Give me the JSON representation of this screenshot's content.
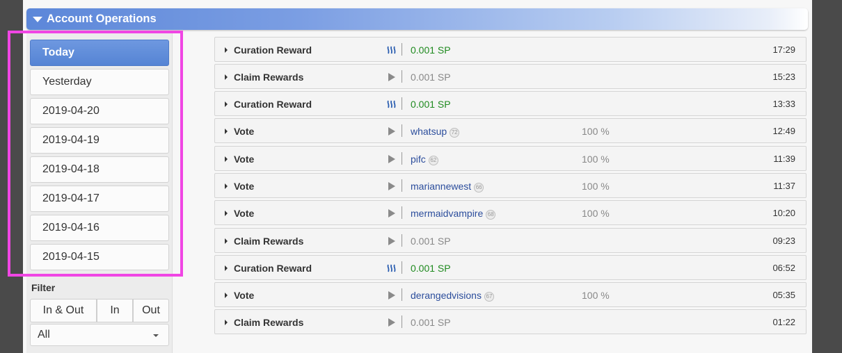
{
  "section": {
    "title": "Account Operations"
  },
  "dates": [
    {
      "label": "Today",
      "active": true
    },
    {
      "label": "Yesterday",
      "active": false
    },
    {
      "label": "2019-04-20",
      "active": false
    },
    {
      "label": "2019-04-19",
      "active": false
    },
    {
      "label": "2019-04-18",
      "active": false
    },
    {
      "label": "2019-04-17",
      "active": false
    },
    {
      "label": "2019-04-16",
      "active": false
    },
    {
      "label": "2019-04-15",
      "active": false
    }
  ],
  "filter": {
    "label": "Filter",
    "buttons": [
      {
        "label": "In & Out",
        "active": true
      },
      {
        "label": "In",
        "active": false
      },
      {
        "label": "Out",
        "active": false
      }
    ],
    "select_value": "All"
  },
  "operations": [
    {
      "title": "Curation Reward",
      "icon": "steem-icon",
      "value": "0.001 SP",
      "value_style": "green",
      "time": "17:29"
    },
    {
      "title": "Claim Rewards",
      "icon": "play-icon",
      "value": "0.001 SP",
      "value_style": "gray",
      "time": "15:23"
    },
    {
      "title": "Curation Reward",
      "icon": "steem-icon",
      "value": "0.001 SP",
      "value_style": "green",
      "time": "13:33"
    },
    {
      "title": "Vote",
      "icon": "play-icon",
      "value": "whatsup",
      "value_style": "link",
      "rep": "72",
      "weight": "100 %",
      "time": "12:49"
    },
    {
      "title": "Vote",
      "icon": "play-icon",
      "value": "pifc",
      "value_style": "link",
      "rep": "62",
      "weight": "100 %",
      "time": "11:39"
    },
    {
      "title": "Vote",
      "icon": "play-icon",
      "value": "mariannewest",
      "value_style": "link",
      "rep": "66",
      "weight": "100 %",
      "time": "11:37"
    },
    {
      "title": "Vote",
      "icon": "play-icon",
      "value": "mermaidvampire",
      "value_style": "link",
      "rep": "68",
      "weight": "100 %",
      "time": "10:20"
    },
    {
      "title": "Claim Rewards",
      "icon": "play-icon",
      "value": "0.001 SP",
      "value_style": "gray",
      "time": "09:23"
    },
    {
      "title": "Curation Reward",
      "icon": "steem-icon",
      "value": "0.001 SP",
      "value_style": "green",
      "time": "06:52"
    },
    {
      "title": "Vote",
      "icon": "play-icon",
      "value": "derangedvisions",
      "value_style": "link",
      "rep": "67",
      "weight": "100 %",
      "time": "05:35"
    },
    {
      "title": "Claim Rewards",
      "icon": "play-icon",
      "value": "0.001 SP",
      "value_style": "gray",
      "time": "01:22"
    }
  ],
  "colors": {
    "accent": "#5c87d9",
    "highlight": "#f046e4",
    "green": "#1f8a1f",
    "link": "#2b4d9c"
  }
}
